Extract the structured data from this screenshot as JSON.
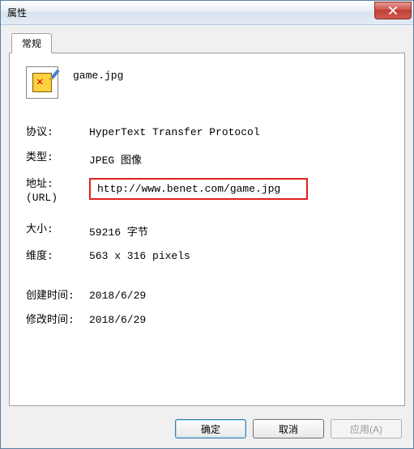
{
  "window": {
    "title": "属性",
    "close_icon": "close"
  },
  "tab": {
    "label": "常规"
  },
  "file": {
    "name": "game.jpg"
  },
  "labels": {
    "protocol": "协议:",
    "type": "类型:",
    "url": "地址:",
    "url2": "(URL)",
    "size": "大小:",
    "dimensions": "维度:",
    "created": "创建时间:",
    "modified": "修改时间:"
  },
  "values": {
    "protocol": "HyperText Transfer Protocol",
    "type": "JPEG 图像",
    "url": "http://www.benet.com/game.jpg",
    "size": "59216 字节",
    "dimensions": "563  x  316  pixels",
    "created": "2018/6/29",
    "modified": "2018/6/29"
  },
  "buttons": {
    "ok": "确定",
    "cancel": "取消",
    "apply": "应用(A)"
  }
}
